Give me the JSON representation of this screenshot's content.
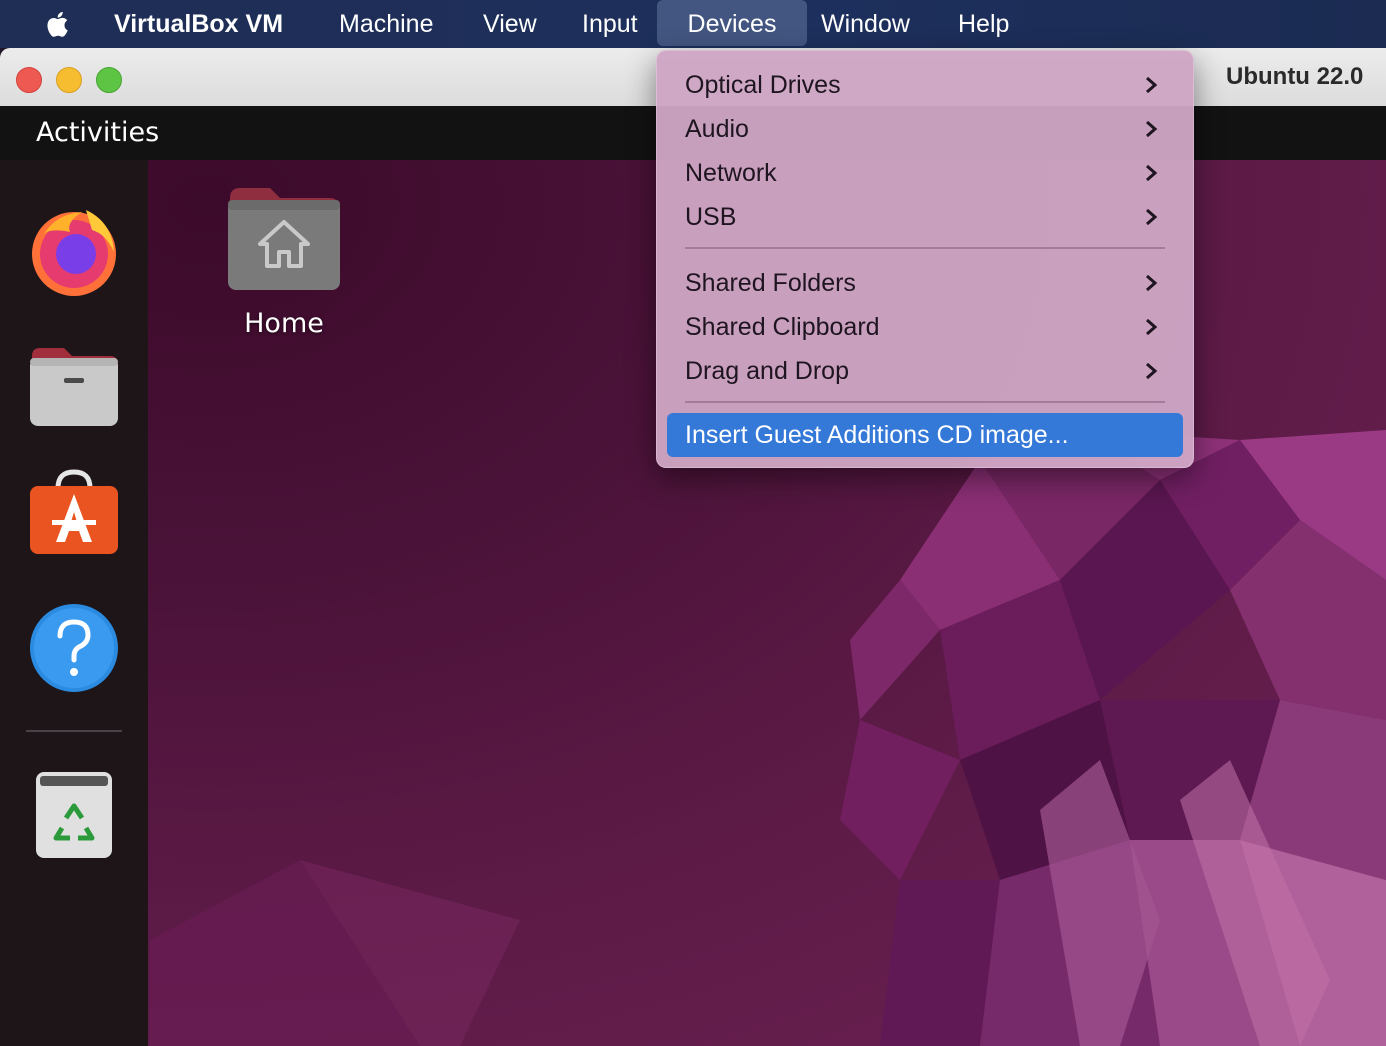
{
  "menubar": {
    "apple_icon": "apple-logo-icon",
    "app_name": "VirtualBox VM",
    "items": [
      "Machine",
      "View",
      "Input",
      "Devices",
      "Window",
      "Help"
    ],
    "active_item": "Devices"
  },
  "window": {
    "title": "Ubuntu 22.0",
    "traffic_lights": [
      "close",
      "minimize",
      "zoom"
    ]
  },
  "ubuntu": {
    "activities_label": "Activities",
    "dock": [
      {
        "name": "Firefox",
        "icon": "firefox-icon"
      },
      {
        "name": "Files",
        "icon": "files-folder-icon"
      },
      {
        "name": "Ubuntu Software",
        "icon": "app-store-icon"
      },
      {
        "name": "Help",
        "icon": "help-icon"
      },
      {
        "name": "Trash",
        "icon": "trash-icon"
      }
    ],
    "desktop_icons": [
      {
        "label": "Home",
        "icon": "home-folder-icon"
      }
    ]
  },
  "devices_menu": {
    "groups": [
      [
        "Optical Drives",
        "Audio",
        "Network",
        "USB"
      ],
      [
        "Shared Folders",
        "Shared Clipboard",
        "Drag and Drop"
      ]
    ],
    "action_item": "Insert Guest Additions CD image...",
    "highlighted": "Insert Guest Additions CD image..."
  },
  "colors": {
    "menubar": "#1d2f5c",
    "menu_background": "#cea6c4",
    "highlight": "#3478d8",
    "desktop": "#5c1a46"
  }
}
